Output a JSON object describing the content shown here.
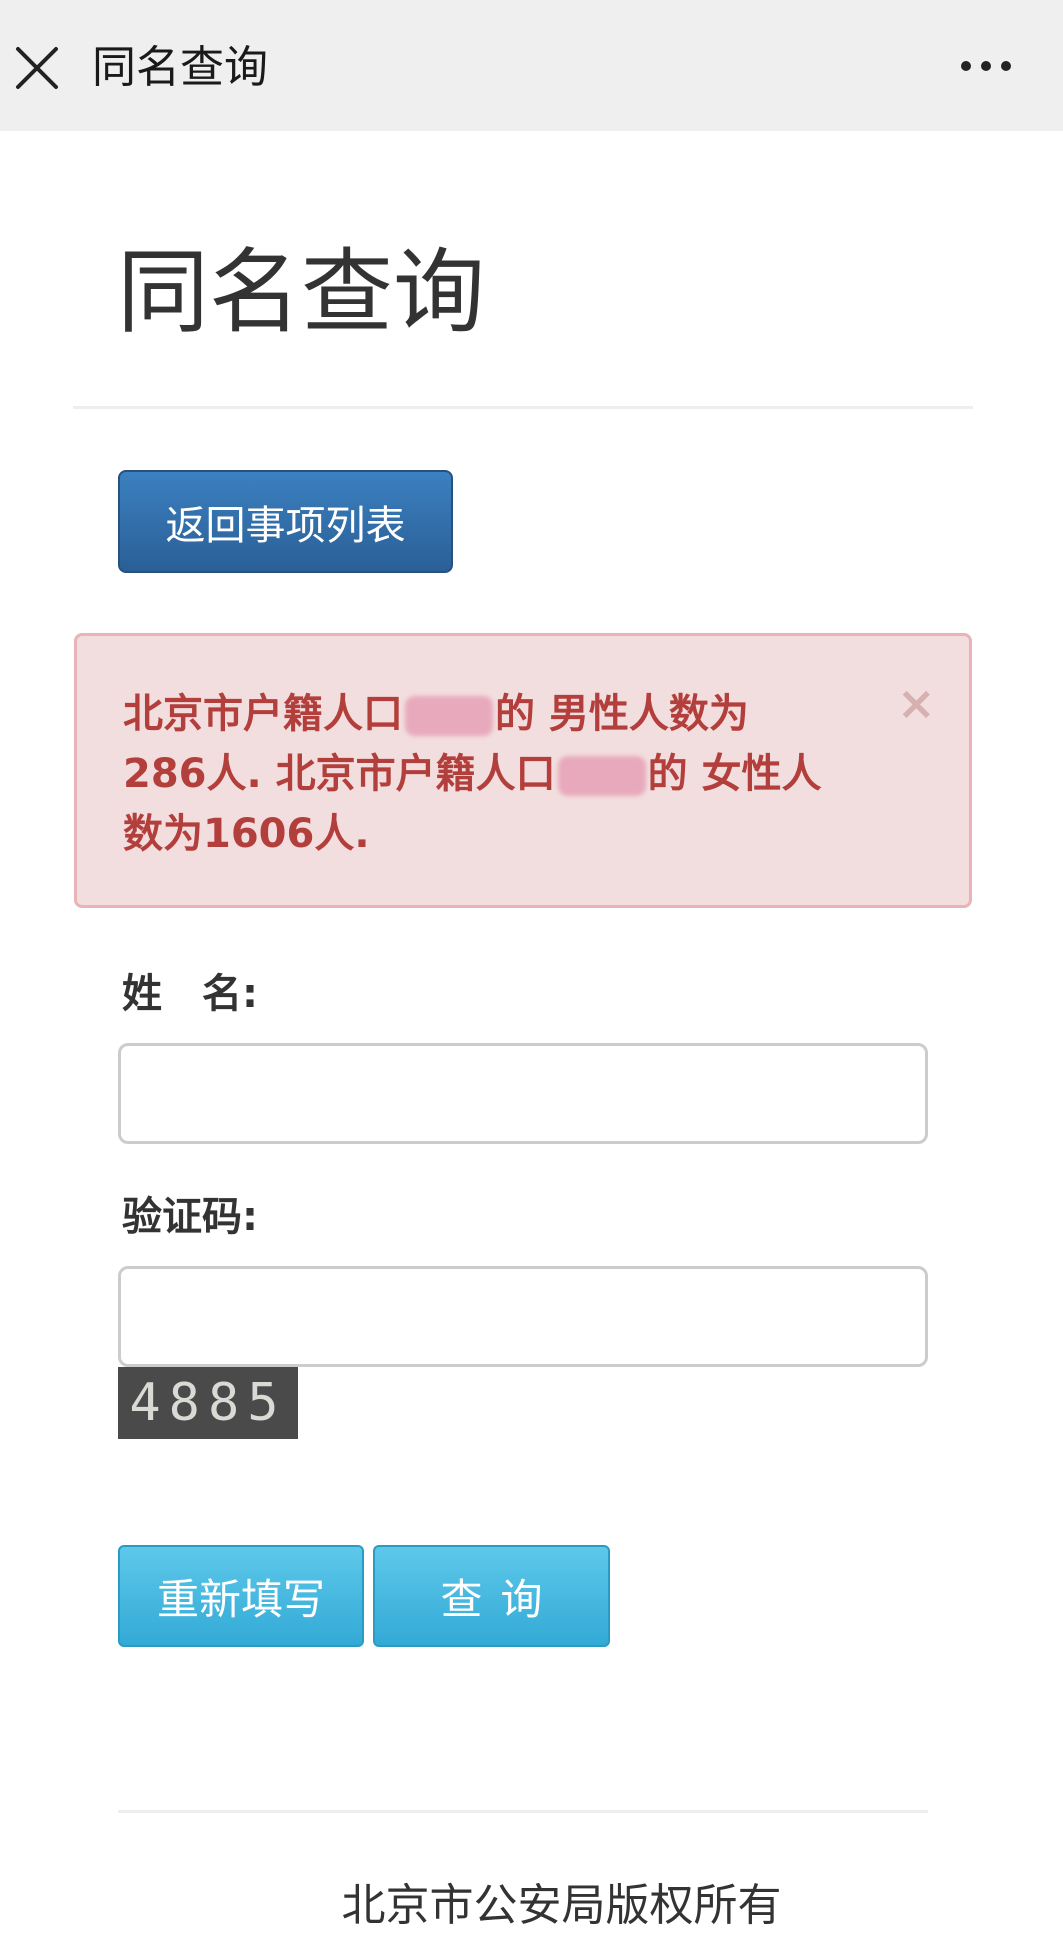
{
  "navbar": {
    "close_icon": "close-x-icon",
    "title": "同名查询",
    "more_icon": "more-dots-icon"
  },
  "page": {
    "title": "同名查询",
    "back_button_label": "返回事项列表"
  },
  "alert": {
    "part1": "北京市户籍人口",
    "part2": "的 男性人数为 286人. 北京市户籍人口",
    "part3": "的 女性人数为1606人.",
    "close_symbol": "×",
    "background_color": "#f2dede",
    "text_color": "#b33f3c"
  },
  "form": {
    "name_label": "姓　名:",
    "name_value": "",
    "captcha_label": "验证码:",
    "captcha_value": "",
    "captcha_image_text": "4885",
    "reset_button_label": "重新填写",
    "query_button_label": "查询"
  },
  "footer": {
    "copyright": "北京市公安局版权所有"
  },
  "colors": {
    "primary_button": "#2a5f96",
    "info_button": "#32aad6",
    "navbar_bg": "#efefef"
  }
}
